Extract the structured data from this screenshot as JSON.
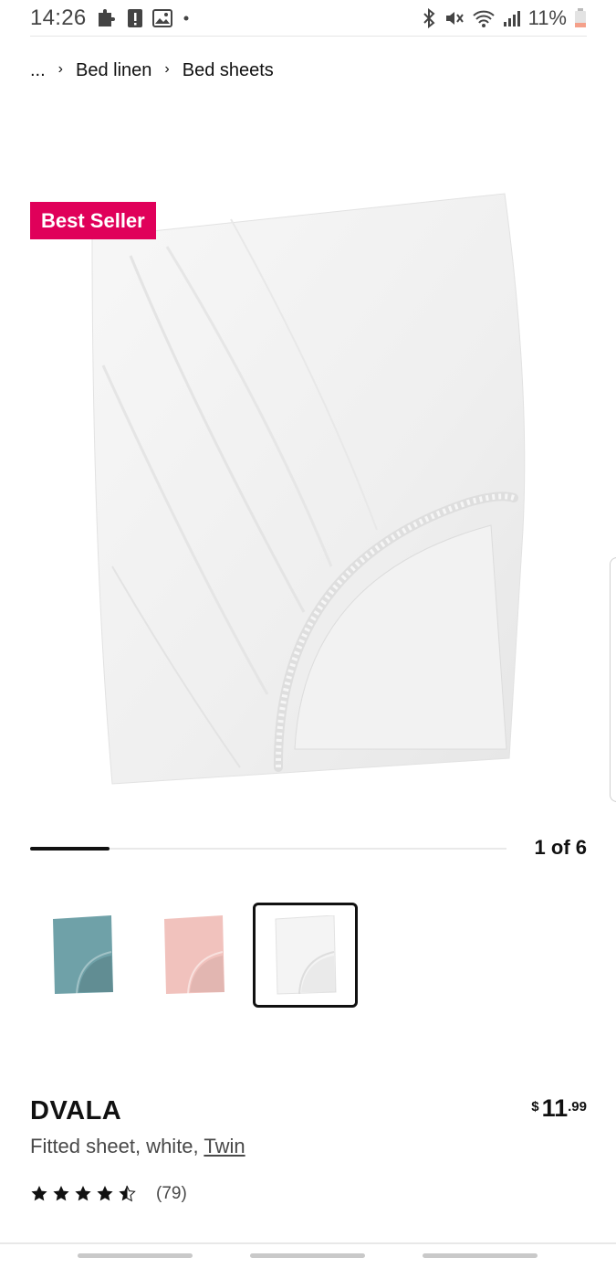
{
  "status_bar": {
    "time": "14:26",
    "battery": "11%",
    "left_icons": [
      "puzzle-icon",
      "alert-icon",
      "image-icon",
      "dot-icon"
    ],
    "right_icons": [
      "bluetooth-icon",
      "mute-icon",
      "wifi-icon",
      "signal-icon",
      "battery-icon"
    ],
    "battery_color": "#f4a08a"
  },
  "breadcrumb": {
    "ellipsis": "...",
    "items": [
      "Bed linen",
      "Bed sheets"
    ]
  },
  "badge": {
    "label": "Best Seller",
    "color": "#e0005a"
  },
  "gallery": {
    "counter": "1 of 6",
    "progress": 0.1667
  },
  "thumbnails": [
    {
      "color_name": "turquoise",
      "color": "#6fa1a8",
      "selected": false
    },
    {
      "color_name": "pink",
      "color": "#f1c2bd",
      "selected": false
    },
    {
      "color_name": "white",
      "color": "#f4f4f4",
      "selected": true
    }
  ],
  "product": {
    "name": "DVALA",
    "description_prefix": "Fitted sheet, white, ",
    "size": "Twin",
    "price_currency": "$",
    "price_integer": "11",
    "price_decimal": ".99",
    "rating": 4.5,
    "review_count": "(79)"
  }
}
